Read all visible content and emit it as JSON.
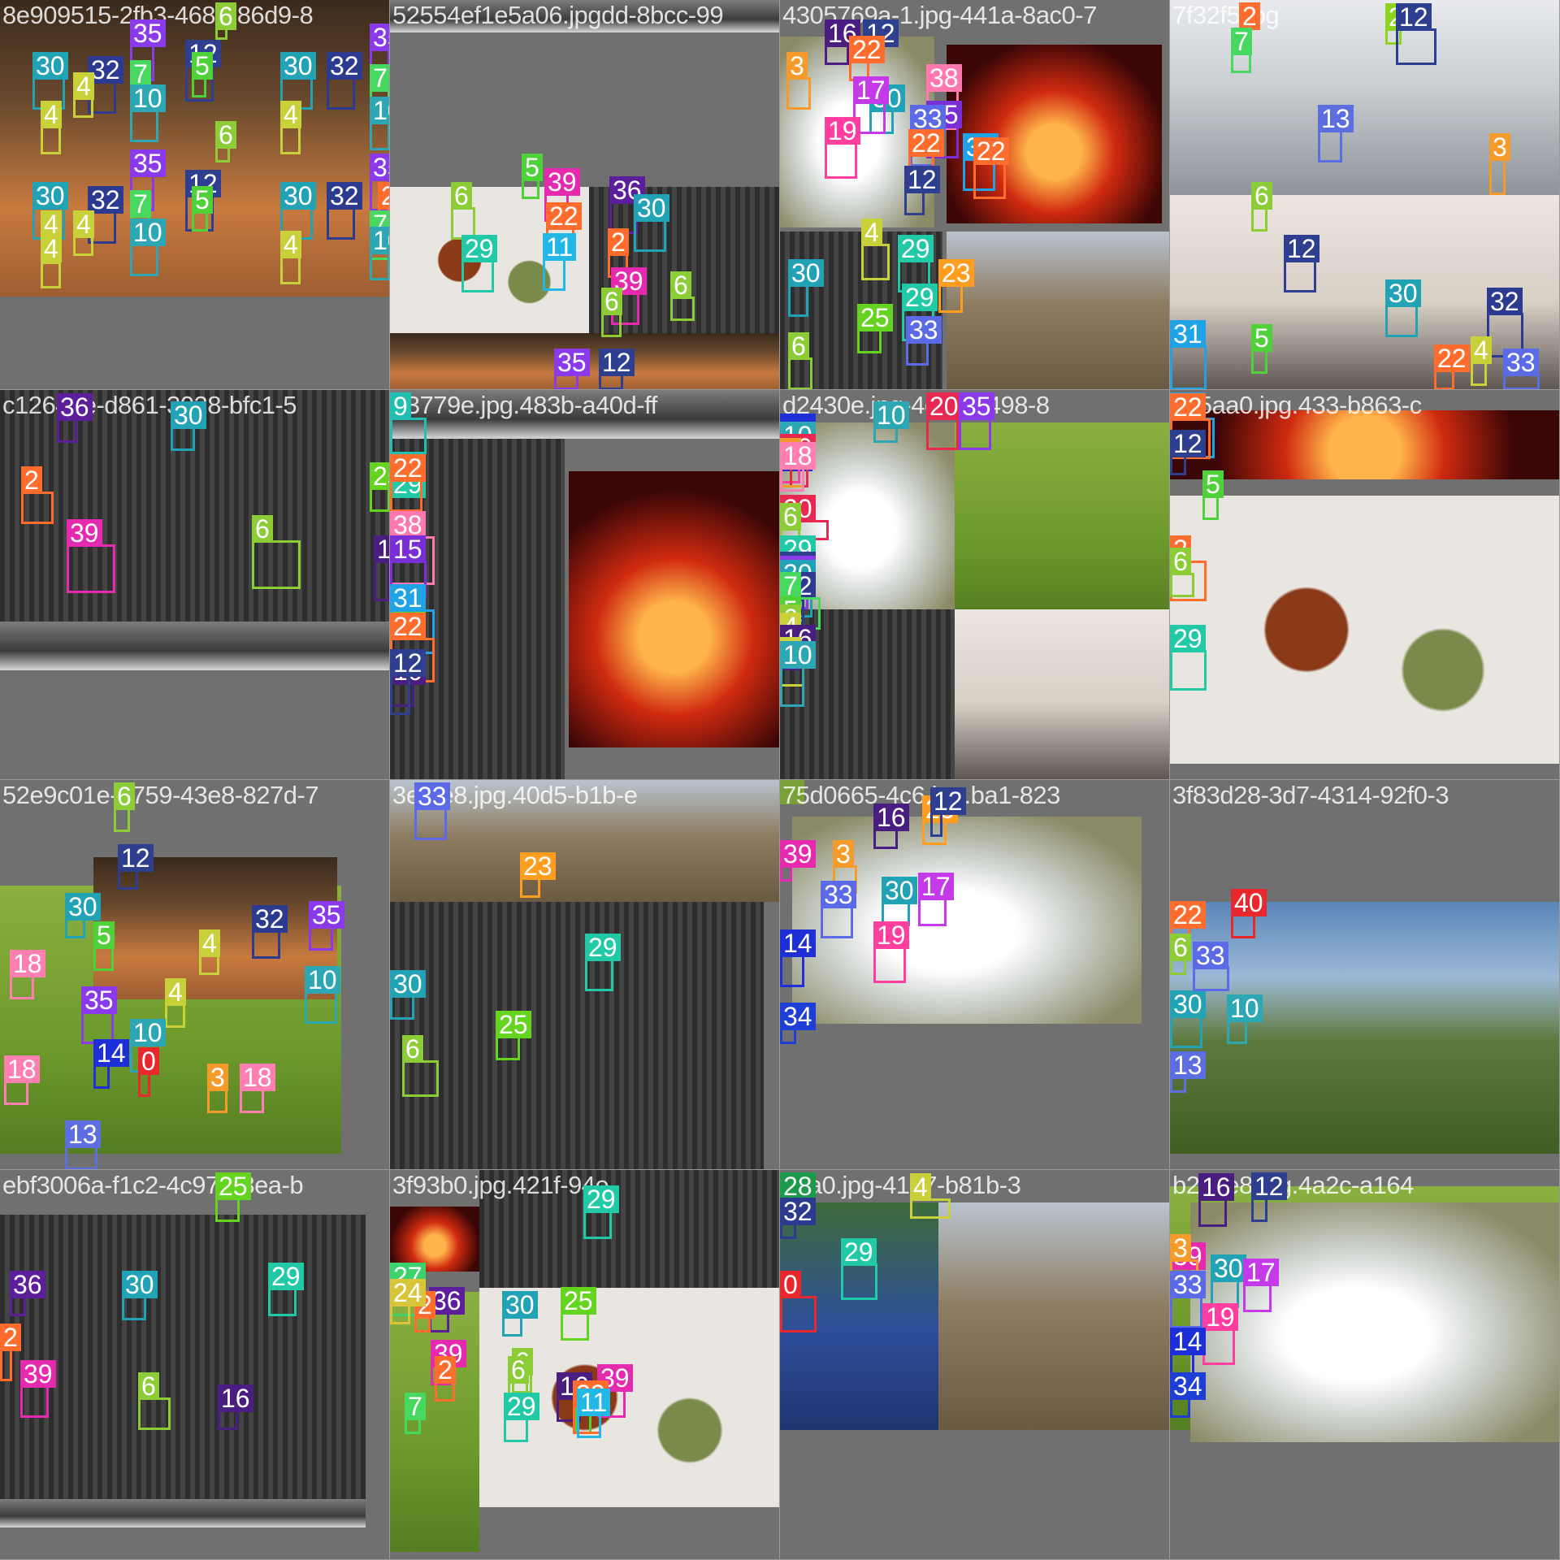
{
  "mosaic": {
    "tiles": [
      {
        "filename": "8e909515-2fb3-4681-86d9-8",
        "labels": [
          "6",
          "35",
          "30",
          "32",
          "12",
          "5",
          "30",
          "32",
          "35",
          "7",
          "4",
          "10",
          "4",
          "7",
          "4",
          "10",
          "4",
          "6",
          "35",
          "30",
          "32",
          "12",
          "5",
          "30",
          "32",
          "35",
          "2",
          "7",
          "4",
          "10",
          "4",
          "7",
          "10",
          "4"
        ]
      },
      {
        "filename": "52554ef1e5a06.jpgdd-8bcc-99",
        "labels": [
          "5",
          "39",
          "36",
          "30",
          "6",
          "22",
          "29",
          "11",
          "2",
          "39",
          "6",
          "6",
          "35",
          "12"
        ]
      },
      {
        "filename": "4305769a-1.jpg-441a-8ac0-7",
        "labels": [
          "16",
          "12",
          "3",
          "22",
          "38",
          "30",
          "17",
          "15",
          "33",
          "19",
          "31",
          "22",
          "22",
          "12",
          "4",
          "29",
          "30",
          "23",
          "25",
          "29",
          "33",
          "6"
        ]
      },
      {
        "filename": "7f32f5.jpg",
        "labels": [
          "2",
          "26",
          "12",
          "7",
          "13",
          "3",
          "6",
          "12",
          "30",
          "32",
          "5",
          "22",
          "4",
          "33",
          "31"
        ]
      },
      {
        "filename": "c12645e-d861-3028-bfc1-5",
        "labels": [
          "36",
          "30",
          "2",
          "25",
          "39",
          "6",
          "16"
        ]
      },
      {
        "filename": "63779e.jpg.483b-a40d-ff",
        "labels": [
          "9",
          "29",
          "22",
          "38",
          "15",
          "25",
          "31",
          "22",
          "16",
          "12"
        ]
      },
      {
        "filename": "d2430e.jpg-4d88-9498-8",
        "labels": [
          "10",
          "20",
          "35",
          "14",
          "22",
          "14",
          "10",
          "19",
          "20",
          "0",
          "3",
          "18",
          "20",
          "6",
          "29",
          "12",
          "35",
          "30",
          "25",
          "30",
          "32",
          "7",
          "5",
          "6",
          "4",
          "16",
          "4",
          "10"
        ]
      },
      {
        "filename": "c25aa0.jpg.433-b863-c",
        "labels": [
          "31",
          "22",
          "12",
          "2",
          "6",
          "29",
          "5"
        ]
      },
      {
        "filename": "52e9c01e-9759-43e8-827d-7",
        "labels": [
          "6",
          "12",
          "30",
          "32",
          "35",
          "18",
          "5",
          "4",
          "10",
          "4",
          "35",
          "14",
          "10",
          "18",
          "0",
          "3",
          "18",
          "13"
        ]
      },
      {
        "filename": "3ef2e8.jpg.40d5-b1b-e",
        "labels": [
          "33",
          "23",
          "29",
          "30",
          "25",
          "6"
        ]
      },
      {
        "filename": "75d0665-4c6.jpg.ba1-823",
        "labels": [
          "23",
          "16",
          "12",
          "39",
          "3",
          "33",
          "30",
          "17",
          "19",
          "14",
          "34"
        ]
      },
      {
        "filename": "3f83d28-3d7-4314-92f0-3",
        "labels": [
          "40",
          "30",
          "10",
          "13",
          "22",
          "6",
          "33"
        ]
      },
      {
        "filename": "ebf3006a-f1c2-4c97-98ea-b",
        "labels": [
          "36",
          "29",
          "30",
          "25",
          "2",
          "39",
          "6",
          "16"
        ]
      },
      {
        "filename": "3f93b0.jpg.421f-94e",
        "labels": [
          "27",
          "36",
          "30",
          "29",
          "2",
          "24",
          "25",
          "39",
          "6",
          "16",
          "5",
          "2",
          "39",
          "7",
          "6",
          "22",
          "11",
          "29"
        ]
      },
      {
        "filename": "c7a0.jpg-4147-b81b-3",
        "labels": [
          "28",
          "4",
          "32",
          "29",
          "0"
        ]
      },
      {
        "filename": "b2c5e8.jpg.4a2c-a164",
        "labels": [
          "16",
          "12",
          "39",
          "3",
          "33",
          "30",
          "17",
          "19",
          "14",
          "34"
        ]
      }
    ]
  },
  "colors": {
    "class_palette": {
      "0": "#e8282c",
      "2": "#ff6d2e",
      "3": "#f59b2c",
      "4": "#c9d13a",
      "5": "#4fd13a",
      "6": "#8ccc37",
      "7": "#47d860",
      "9": "#1fbfb1",
      "10": "#2ea7b5",
      "11": "#22b8e6",
      "12": "#2e3f8f",
      "13": "#5c6ee0",
      "14": "#1d2fd6",
      "15": "#7a2fd6",
      "16": "#4a1d80",
      "17": "#c53ae8",
      "18": "#ff7fb0",
      "19": "#ff3ea0",
      "20": "#e82850",
      "22": "#ff6d2e",
      "23": "#ff9d1e",
      "24": "#d9c53a",
      "25": "#65d420",
      "26": "#8cd41e",
      "27": "#3cd36e",
      "28": "#1c9a4c",
      "29": "#22c9a6",
      "30": "#22a2b5",
      "31": "#20a3e6",
      "32": "#2c3b90",
      "33": "#5b6ae6",
      "34": "#1e3fd6",
      "35": "#8a3aeb",
      "36": "#5c1e9a",
      "38": "#ff78b0",
      "39": "#e62ab0",
      "40": "#e8282c"
    }
  }
}
